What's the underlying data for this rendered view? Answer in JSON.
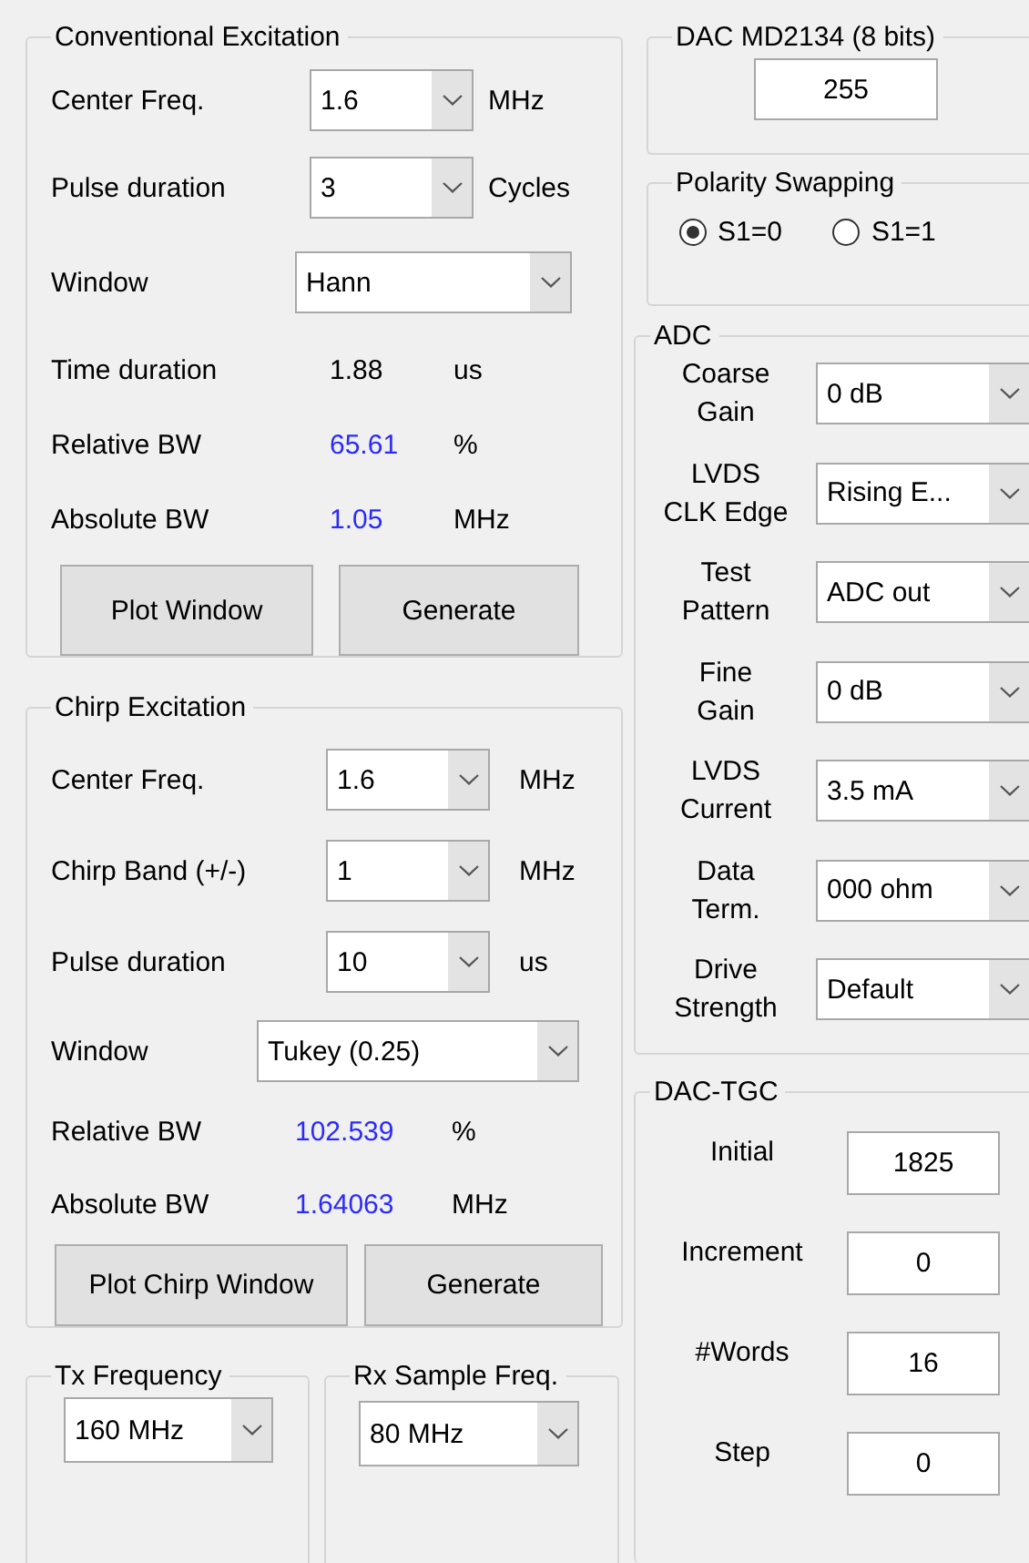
{
  "conventional_excitation": {
    "title": "Conventional Excitation",
    "rows": [
      {
        "kind": "combo",
        "label": "Center Freq.",
        "value": "1.6",
        "unit": "MHz"
      },
      {
        "kind": "combo",
        "label": "Pulse duration",
        "value": "3",
        "unit": "Cycles"
      },
      {
        "kind": "wide_combo",
        "label": "Window",
        "value": "Hann"
      },
      {
        "kind": "readout",
        "label": "Time duration",
        "value": "1.88",
        "unit": "us",
        "color": "#000000"
      },
      {
        "kind": "readout",
        "label": "Relative BW",
        "value": "65.61",
        "unit": "%",
        "color": "#2a2aff"
      },
      {
        "kind": "readout",
        "label": "Absolute BW",
        "value": "1.05",
        "unit": "MHz",
        "color": "#2a2aff"
      }
    ],
    "buttons": [
      "Plot Window",
      "Generate"
    ]
  },
  "chirp_excitation": {
    "title": "Chirp Excitation",
    "rows": [
      {
        "kind": "combo",
        "label": "Center Freq.",
        "value": "1.6",
        "unit": "MHz"
      },
      {
        "kind": "combo",
        "label": "Chirp Band (+/-)",
        "value": "1",
        "unit": "MHz"
      },
      {
        "kind": "combo",
        "label": "Pulse duration",
        "value": "10",
        "unit": "us"
      },
      {
        "kind": "wide_combo",
        "label": "Window",
        "value": "Tukey (0.25)"
      },
      {
        "kind": "readout",
        "label": "Relative BW",
        "value": "102.539",
        "unit": "%",
        "color": "#2a2aff"
      },
      {
        "kind": "readout",
        "label": "Absolute BW",
        "value": "1.64063",
        "unit": "MHz",
        "color": "#2a2aff"
      }
    ],
    "buttons": [
      "Plot Chirp Window",
      "Generate"
    ]
  },
  "tx_frequency": {
    "title": "Tx Frequency",
    "value": "160 MHz"
  },
  "rx_sample_freq": {
    "title": "Rx Sample Freq.",
    "value": "80 MHz"
  },
  "dac": {
    "title": "DAC MD2134 (8 bits)",
    "value": "255"
  },
  "polarity_swapping": {
    "title": "Polarity Swapping",
    "options": [
      {
        "label": "S1=0",
        "selected": true
      },
      {
        "label": "S1=1",
        "selected": false
      }
    ]
  },
  "adc": {
    "title": "ADC",
    "rows": [
      {
        "label": "Coarse\nGain",
        "value": "0 dB"
      },
      {
        "label": "LVDS\nCLK Edge",
        "value": "Rising E..."
      },
      {
        "label": "Test\nPattern",
        "value": "ADC out"
      },
      {
        "label": "Fine\nGain",
        "value": "0 dB"
      },
      {
        "label": "LVDS\nCurrent",
        "value": "3.5 mA"
      },
      {
        "label": "Data\nTerm.",
        "value": "000 ohm"
      },
      {
        "label": "Drive\nStrength",
        "value": "Default"
      }
    ]
  },
  "dac_tgc": {
    "title": "DAC-TGC",
    "rows": [
      {
        "label": "Initial",
        "value": "1825"
      },
      {
        "label": "Increment",
        "value": "0"
      },
      {
        "label": "#Words",
        "value": "16"
      },
      {
        "label": "Step",
        "value": "0"
      }
    ]
  }
}
